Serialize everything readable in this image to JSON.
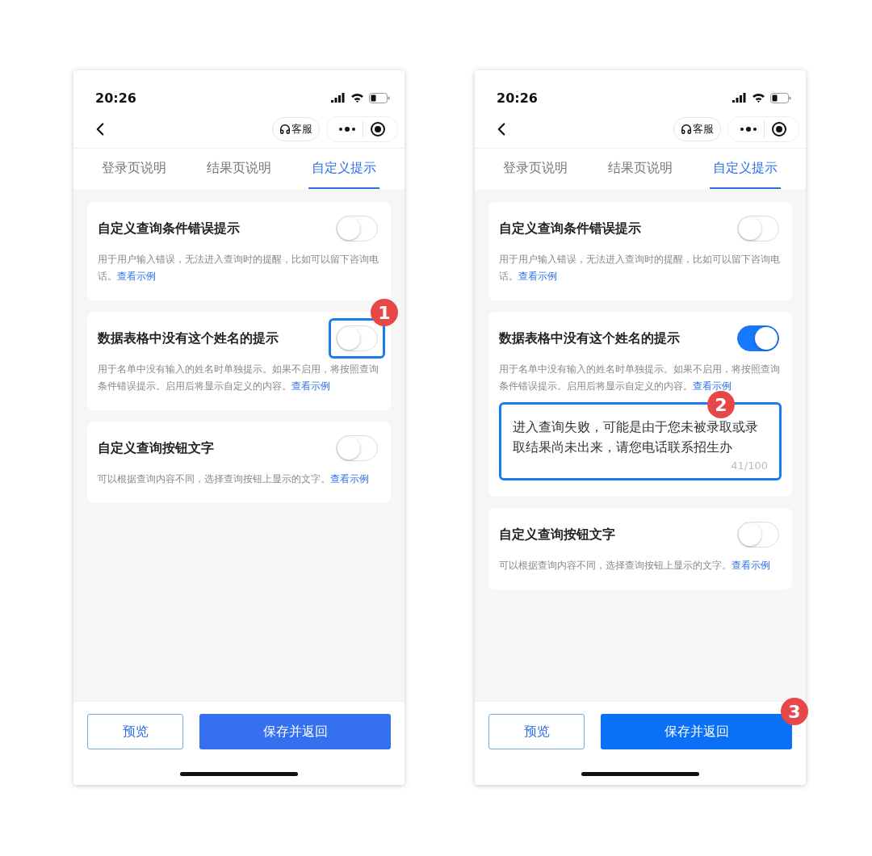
{
  "phones": [
    {
      "status_bar": {
        "time": "20:26"
      },
      "nav": {
        "service_label": "客服"
      },
      "tabs": [
        {
          "label": "登录页说明",
          "selected": false
        },
        {
          "label": "结果页说明",
          "selected": false
        },
        {
          "label": "自定义提示",
          "selected": true
        }
      ],
      "cards": [
        {
          "title": "自定义查询条件错误提示",
          "description": "用于用户输入错误，无法进入查询时的提醒，比如可以留下咨询电话。",
          "link": "查看示例",
          "on": false,
          "highlighted": false
        },
        {
          "title": "数据表格中没有这个姓名的提示",
          "description": "用于名单中没有输入的姓名时单独提示。如果不启用，将按照查询条件错误提示。启用后将显示自定义的内容。",
          "link": "查看示例",
          "on": false,
          "highlighted": true,
          "badge": "1"
        },
        {
          "title": "自定义查询按钮文字",
          "description": "可以根据查询内容不同，选择查询按钮上显示的文字。",
          "link": "查看示例",
          "on": false,
          "highlighted": false
        }
      ],
      "footer": {
        "preview_label": "预览",
        "save_label": "保存并返回"
      }
    },
    {
      "status_bar": {
        "time": "20:26"
      },
      "nav": {
        "service_label": "客服"
      },
      "tabs": [
        {
          "label": "登录页说明",
          "selected": false
        },
        {
          "label": "结果页说明",
          "selected": false
        },
        {
          "label": "自定义提示",
          "selected": true
        }
      ],
      "cards": [
        {
          "title": "自定义查询条件错误提示",
          "description": "用于用户输入错误，无法进入查询时的提醒，比如可以留下咨询电话。",
          "link": "查看示例",
          "on": false,
          "highlighted": false
        },
        {
          "title": "数据表格中没有这个姓名的提示",
          "description": "用于名单中没有输入的姓名时单独提示。如果不启用，将按照查询条件错误提示。启用后将显示自定义的内容。",
          "link": "查看示例",
          "on": true,
          "highlighted": false,
          "textarea": {
            "value": "进入查询失败，可能是由于您未被录取或录取结果尚未出来，请您电话联系招生办",
            "counter": "41/100",
            "badge": "2"
          }
        },
        {
          "title": "自定义查询按钮文字",
          "description": "可以根据查询内容不同，选择查询按钮上显示的文字。",
          "link": "查看示例",
          "on": false,
          "highlighted": false
        }
      ],
      "footer": {
        "preview_label": "预览",
        "save_label": "保存并返回",
        "save_badge": "3"
      }
    }
  ]
}
